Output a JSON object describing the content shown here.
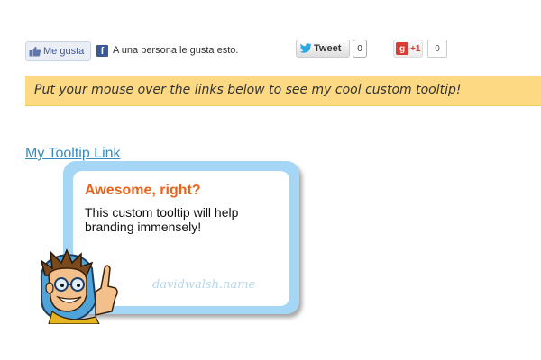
{
  "social": {
    "facebook": {
      "like_label": "Me gusta",
      "count_text": "A una persona le gusta esto."
    },
    "twitter": {
      "tweet_label": "Tweet",
      "count": "0"
    },
    "google_plus": {
      "label": "+1",
      "count": "0"
    }
  },
  "notice": {
    "text": "Put your mouse over the links below to see my cool custom tooltip!"
  },
  "tooltip_link": {
    "label": "My Tooltip Link"
  },
  "tooltip": {
    "title": "Awesome, right?",
    "body": "This custom tooltip will help branding immensely!",
    "signature": "davidwalsh.name"
  },
  "colors": {
    "notice_bg": "#fcd982",
    "link": "#3a8bbb",
    "tooltip_border": "#a5d6f5",
    "tooltip_title": "#e8641c"
  }
}
